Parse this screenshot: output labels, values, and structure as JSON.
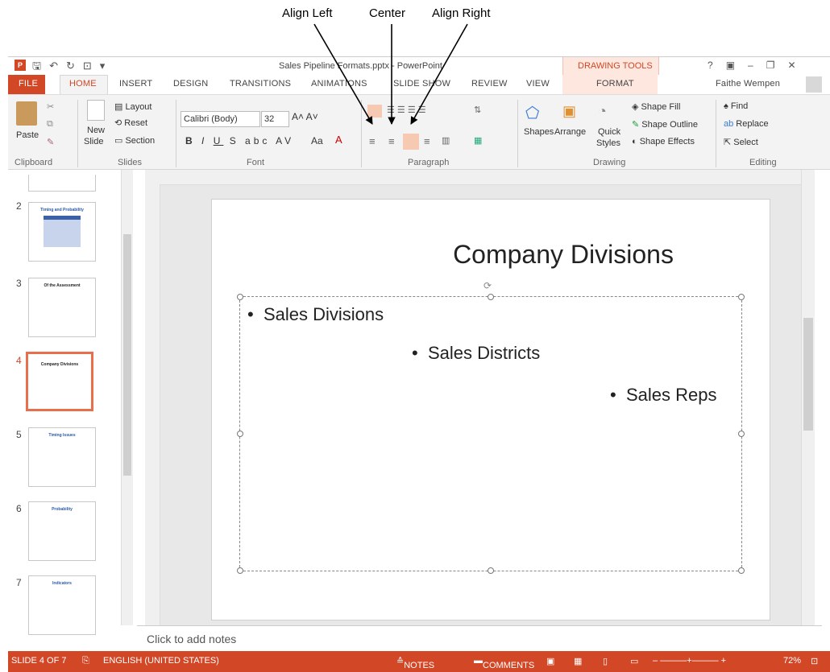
{
  "callouts": {
    "align_left": "Align Left",
    "center": "Center",
    "align_right": "Align Right"
  },
  "title": {
    "app_title": "Sales Pipeline Formats.pptx - PowerPoint",
    "context_tab": "DRAWING TOOLS",
    "window_controls": [
      "?",
      "▣",
      "–",
      "❐",
      "✕"
    ]
  },
  "tabs": [
    "FILE",
    "HOME",
    "INSERT",
    "DESIGN",
    "TRANSITIONS",
    "ANIMATIONS",
    "SLIDE SHOW",
    "REVIEW",
    "VIEW",
    "FORMAT"
  ],
  "user": "Faithe Wempen",
  "ribbon": {
    "clipboard": {
      "paste": "Paste",
      "label": "Clipboard"
    },
    "slides": {
      "new_slide": "New",
      "new_slide2": "Slide",
      "layout": "Layout",
      "reset": "Reset",
      "section": "Section",
      "label": "Slides"
    },
    "font": {
      "name": "Calibri (Body)",
      "size": "32",
      "label": "Font",
      "clear": "Aa"
    },
    "paragraph": {
      "label": "Paragraph"
    },
    "drawing": {
      "shapes": "Shapes",
      "arrange": "Arrange",
      "quick": "Quick",
      "styles": "Styles",
      "fill": "Shape Fill",
      "outline": "Shape Outline",
      "effects": "Shape Effects",
      "label": "Drawing"
    },
    "editing": {
      "find": "Find",
      "replace": "Replace",
      "select": "Select",
      "label": "Editing"
    }
  },
  "thumbnails": [
    {
      "num": "2",
      "title": "Timing and Probability"
    },
    {
      "num": "3",
      "title": "Of the Assessment"
    },
    {
      "num": "4",
      "title": "Company Divisions"
    },
    {
      "num": "5",
      "title": "Timing Issues"
    },
    {
      "num": "6",
      "title": "Probability"
    },
    {
      "num": "7",
      "title": "Indicators"
    }
  ],
  "slide": {
    "title": "Company Divisions",
    "bullets": [
      "Sales Divisions",
      "Sales Districts",
      "Sales Reps"
    ]
  },
  "notes": "Click to add notes",
  "status": {
    "slide": "SLIDE 4 OF 7",
    "language": "ENGLISH (UNITED STATES)",
    "notes": "NOTES",
    "comments": "COMMENTS",
    "zoom": "72%"
  }
}
